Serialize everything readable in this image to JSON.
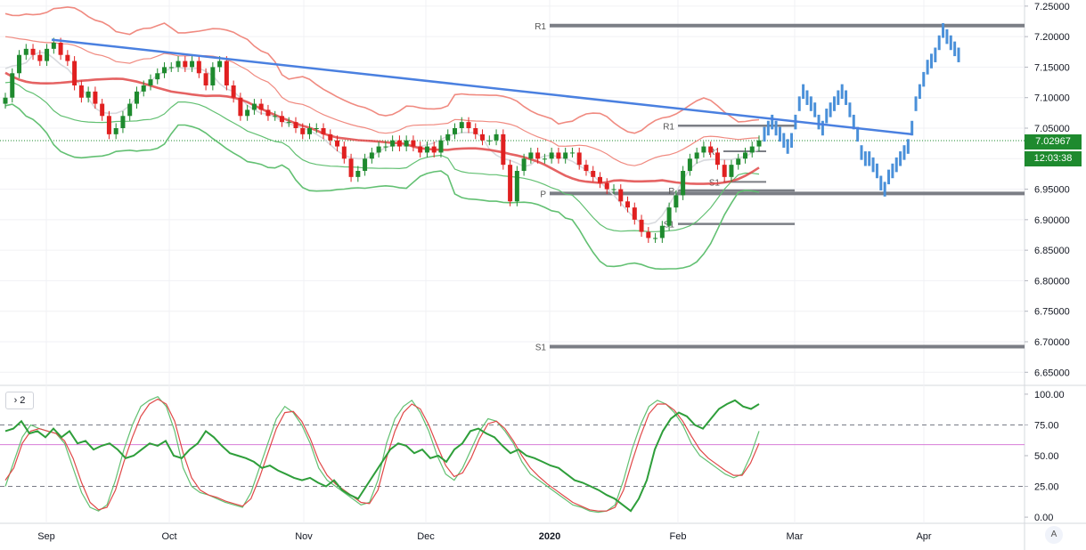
{
  "chart_data": [
    {
      "type": "candlestick",
      "title": "",
      "x_ticks": [
        "Sep",
        "Oct",
        "Nov",
        "Dec",
        "2020",
        "Feb",
        "Mar",
        "Apr"
      ],
      "y_ticks": [
        "7.25000",
        "7.20000",
        "7.15000",
        "7.10000",
        "7.05000",
        "7.00000",
        "6.95000",
        "6.90000",
        "6.85000",
        "6.80000",
        "6.75000",
        "6.70000",
        "6.65000"
      ],
      "ylim": [
        6.63,
        7.26
      ],
      "current_price": "7.02967",
      "countdown": "12:03:38",
      "price_color": "#1e8a2e",
      "levels": [
        {
          "label": "R1",
          "value": 7.218
        },
        {
          "label": "P",
          "value": 6.943
        },
        {
          "label": "S1",
          "value": 6.692
        },
        {
          "label": "R1",
          "value": 7.054
        },
        {
          "label": "P",
          "value": 6.948
        },
        {
          "label": "S1",
          "value": 6.893
        },
        {
          "label": "R1",
          "value": 7.012
        },
        {
          "label": "S1",
          "value": 6.962
        }
      ],
      "trendline": {
        "start": 7.195,
        "end": 7.04,
        "color": "#4a80e0"
      },
      "close_series": [
        7.1,
        7.14,
        7.17,
        7.18,
        7.17,
        7.16,
        7.18,
        7.19,
        7.17,
        7.16,
        7.12,
        7.1,
        7.11,
        7.09,
        7.07,
        7.04,
        7.05,
        7.07,
        7.09,
        7.11,
        7.12,
        7.13,
        7.14,
        7.15,
        7.15,
        7.16,
        7.15,
        7.16,
        7.14,
        7.12,
        7.15,
        7.16,
        7.12,
        7.1,
        7.07,
        7.08,
        7.09,
        7.08,
        7.07,
        7.07,
        7.06,
        7.06,
        7.05,
        7.04,
        7.05,
        7.05,
        7.04,
        7.03,
        7.02,
        7.0,
        6.97,
        6.98,
        7.0,
        7.01,
        7.02,
        7.02,
        7.03,
        7.02,
        7.03,
        7.02,
        7.01,
        7.02,
        7.01,
        7.03,
        7.04,
        7.05,
        7.06,
        7.05,
        7.04,
        7.03,
        7.03,
        7.04,
        6.99,
        6.93,
        6.98,
        7.0,
        7.01,
        7.0,
        7.0,
        7.01,
        7.0,
        7.01,
        7.01,
        6.99,
        6.98,
        6.97,
        6.96,
        6.95,
        6.95,
        6.93,
        6.92,
        6.9,
        6.88,
        6.87,
        6.87,
        6.89,
        6.92,
        6.94,
        6.98,
        7.0,
        7.01,
        7.02,
        7.01,
        6.99,
        6.97,
        6.99,
        7.0,
        7.01,
        7.02,
        7.03
      ],
      "projection_series": [
        7.04,
        7.05,
        7.06,
        7.05,
        7.04,
        7.03,
        7.02,
        7.03,
        7.06,
        7.09,
        7.11,
        7.1,
        7.09,
        7.08,
        7.06,
        7.05,
        7.07,
        7.08,
        7.09,
        7.1,
        7.11,
        7.1,
        7.08,
        7.06,
        7.04,
        7.01,
        7.0,
        7.0,
        6.99,
        6.98,
        6.96,
        6.95,
        6.97,
        6.98,
        6.99,
        7.0,
        7.01,
        7.02,
        7.05,
        7.09,
        7.11,
        7.13,
        7.15,
        7.16,
        7.17,
        7.19,
        7.21,
        7.2,
        7.19,
        7.18,
        7.17
      ],
      "ma_color": "#e04848",
      "upper_band_color": "#f08a80",
      "lower_band_color": "#62c072"
    },
    {
      "type": "line",
      "title": "",
      "pane_label": "› 2",
      "y_ticks": [
        "100.00",
        "75.00",
        "50.00",
        "25.00",
        "0.00"
      ],
      "ylim": [
        -5,
        105
      ],
      "reference_lines": [
        75,
        25
      ],
      "midline": 59,
      "series_colors": [
        "#2e9e3a",
        "#e04848",
        "#62c072"
      ],
      "main_series": [
        70,
        72,
        78,
        68,
        70,
        65,
        72,
        65,
        70,
        60,
        62,
        55,
        58,
        60,
        55,
        48,
        50,
        55,
        60,
        58,
        62,
        50,
        48,
        55,
        60,
        70,
        65,
        58,
        52,
        50,
        48,
        45,
        40,
        42,
        38,
        35,
        32,
        30,
        32,
        28,
        25,
        30,
        22,
        18,
        15,
        25,
        35,
        45,
        55,
        60,
        58,
        52,
        55,
        48,
        50,
        45,
        55,
        60,
        70,
        72,
        68,
        65,
        58,
        52,
        55,
        50,
        48,
        45,
        42,
        40,
        35,
        30,
        28,
        25,
        22,
        18,
        15,
        10,
        5,
        15,
        30,
        55,
        70,
        80,
        85,
        82,
        75,
        72,
        80,
        88,
        92,
        95,
        90,
        88,
        92
      ],
      "fast_series": [
        25,
        45,
        65,
        75,
        72,
        70,
        68,
        60,
        40,
        20,
        8,
        5,
        10,
        30,
        55,
        75,
        90,
        95,
        98,
        90,
        70,
        40,
        25,
        20,
        18,
        15,
        12,
        10,
        8,
        20,
        40,
        60,
        80,
        90,
        85,
        75,
        60,
        40,
        30,
        25,
        20,
        15,
        10,
        12,
        30,
        60,
        80,
        90,
        95,
        85,
        70,
        50,
        35,
        30,
        40,
        55,
        70,
        80,
        78,
        70,
        60,
        45,
        35,
        30,
        25,
        20,
        15,
        10,
        8,
        5,
        4,
        5,
        10,
        30,
        55,
        75,
        90,
        95,
        92,
        85,
        75,
        60,
        50,
        45,
        40,
        35,
        32,
        35,
        50,
        70
      ],
      "slow_series": [
        30,
        40,
        60,
        70,
        72,
        70,
        68,
        62,
        48,
        28,
        12,
        6,
        8,
        22,
        45,
        65,
        82,
        92,
        96,
        92,
        78,
        52,
        32,
        22,
        18,
        16,
        13,
        11,
        9,
        15,
        32,
        52,
        72,
        85,
        86,
        78,
        64,
        46,
        34,
        27,
        22,
        17,
        12,
        11,
        22,
        48,
        70,
        85,
        92,
        88,
        75,
        58,
        42,
        33,
        36,
        48,
        64,
        76,
        78,
        72,
        62,
        50,
        40,
        33,
        27,
        22,
        17,
        12,
        9,
        6,
        5,
        5,
        8,
        22,
        45,
        66,
        84,
        92,
        92,
        87,
        78,
        66,
        55,
        48,
        43,
        38,
        34,
        34,
        44,
        60
      ]
    }
  ]
}
